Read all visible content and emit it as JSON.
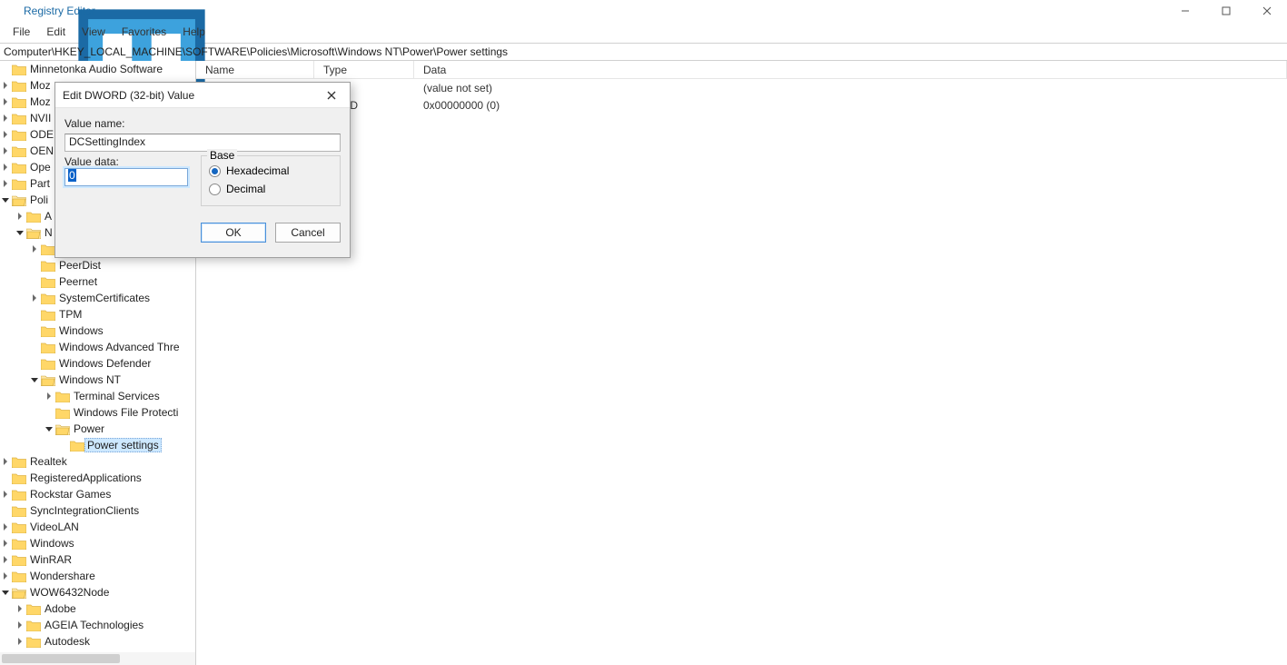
{
  "window": {
    "title": "Registry Editor",
    "controls": {
      "min": "–",
      "max": "□",
      "close": "×"
    }
  },
  "menu": {
    "items": [
      "File",
      "Edit",
      "View",
      "Favorites",
      "Help"
    ]
  },
  "address": {
    "path": "Computer\\HKEY_LOCAL_MACHINE\\SOFTWARE\\Policies\\Microsoft\\Windows NT\\Power\\Power settings"
  },
  "list": {
    "columns": {
      "name": "Name",
      "type": "Type",
      "data": "Data"
    },
    "rows": [
      {
        "name": "",
        "type": "",
        "data": "(value not set)"
      },
      {
        "name": "",
        "type": "WORD",
        "data": "0x00000000 (0)"
      }
    ]
  },
  "tree": {
    "items": [
      {
        "depth": 1,
        "exp": "",
        "label": "Minnetonka Audio Software"
      },
      {
        "depth": 1,
        "exp": "closed",
        "label": "Moz"
      },
      {
        "depth": 1,
        "exp": "closed",
        "label": "Moz"
      },
      {
        "depth": 1,
        "exp": "closed",
        "label": "NVII"
      },
      {
        "depth": 1,
        "exp": "closed",
        "label": "ODE"
      },
      {
        "depth": 1,
        "exp": "closed",
        "label": "OEN"
      },
      {
        "depth": 1,
        "exp": "closed",
        "label": "Ope"
      },
      {
        "depth": 1,
        "exp": "closed",
        "label": "Part"
      },
      {
        "depth": 1,
        "exp": "open",
        "label": "Poli"
      },
      {
        "depth": 2,
        "exp": "closed",
        "label": "A"
      },
      {
        "depth": 2,
        "exp": "open",
        "label": "N"
      },
      {
        "depth": 3,
        "exp": "closed",
        "label": ""
      },
      {
        "depth": 3,
        "exp": "",
        "label": "PeerDist"
      },
      {
        "depth": 3,
        "exp": "",
        "label": "Peernet"
      },
      {
        "depth": 3,
        "exp": "closed",
        "label": "SystemCertificates"
      },
      {
        "depth": 3,
        "exp": "",
        "label": "TPM"
      },
      {
        "depth": 3,
        "exp": "",
        "label": "Windows"
      },
      {
        "depth": 3,
        "exp": "",
        "label": "Windows Advanced Thre"
      },
      {
        "depth": 3,
        "exp": "",
        "label": "Windows Defender"
      },
      {
        "depth": 3,
        "exp": "open",
        "label": "Windows NT"
      },
      {
        "depth": 4,
        "exp": "closed",
        "label": "Terminal Services"
      },
      {
        "depth": 4,
        "exp": "",
        "label": "Windows File Protecti"
      },
      {
        "depth": 4,
        "exp": "open",
        "label": "Power"
      },
      {
        "depth": 5,
        "exp": "",
        "label": "Power settings",
        "selected": true
      },
      {
        "depth": 1,
        "exp": "closed",
        "label": "Realtek"
      },
      {
        "depth": 1,
        "exp": "",
        "label": "RegisteredApplications"
      },
      {
        "depth": 1,
        "exp": "closed",
        "label": "Rockstar Games"
      },
      {
        "depth": 1,
        "exp": "",
        "label": "SyncIntegrationClients"
      },
      {
        "depth": 1,
        "exp": "closed",
        "label": "VideoLAN"
      },
      {
        "depth": 1,
        "exp": "closed",
        "label": "Windows"
      },
      {
        "depth": 1,
        "exp": "closed",
        "label": "WinRAR"
      },
      {
        "depth": 1,
        "exp": "closed",
        "label": "Wondershare"
      },
      {
        "depth": 1,
        "exp": "open",
        "label": "WOW6432Node"
      },
      {
        "depth": 2,
        "exp": "closed",
        "label": "Adobe"
      },
      {
        "depth": 2,
        "exp": "closed",
        "label": "AGEIA Technologies"
      },
      {
        "depth": 2,
        "exp": "closed",
        "label": "Autodesk"
      }
    ]
  },
  "dialog": {
    "title": "Edit DWORD (32-bit) Value",
    "label_value_name": "Value name:",
    "value_name": "DCSettingIndex",
    "label_value_data": "Value data:",
    "value_data": "0",
    "base_legend": "Base",
    "radio_hex": "Hexadecimal",
    "radio_dec": "Decimal",
    "base_selected": "hex",
    "ok": "OK",
    "cancel": "Cancel"
  }
}
